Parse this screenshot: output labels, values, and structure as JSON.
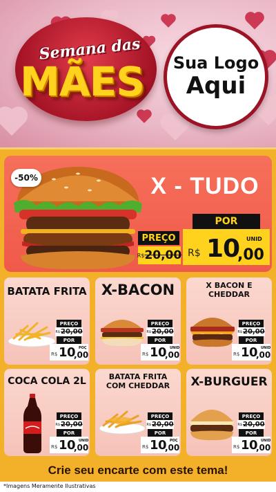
{
  "header": {
    "title_line1": "Semana das",
    "title_line2": "MÃES",
    "logo_line1": "Sua Logo",
    "logo_line2": "Aqui"
  },
  "featured": {
    "discount": "-50%",
    "name": "X - TUDO",
    "price_label": "PREÇO",
    "old_prefix": "R$",
    "old_price": "20,00",
    "por_label": "POR",
    "currency": "R$",
    "price_int": "10",
    "price_dec": ",00",
    "unit": "UNID"
  },
  "products": [
    {
      "name": "BATATA FRITA",
      "icon": "french-fries-icon",
      "price_label": "PREÇO",
      "old_prefix": "R$",
      "old_price": "20,00",
      "por_label": "POR",
      "currency": "R$",
      "price_int": "10",
      "price_dec": ",00",
      "unit": "POÇ"
    },
    {
      "name": "X-BACON",
      "icon": "burger-icon",
      "price_label": "PREÇO",
      "old_prefix": "R$",
      "old_price": "20,00",
      "por_label": "POR",
      "currency": "R$",
      "price_int": "10",
      "price_dec": ",00",
      "unit": "UNID"
    },
    {
      "name": "X BACON E CHEDDAR",
      "icon": "burger-icon",
      "price_label": "PREÇO",
      "old_prefix": "R$",
      "old_price": "20,00",
      "por_label": "POR",
      "currency": "R$",
      "price_int": "10",
      "price_dec": ",00",
      "unit": "UNID"
    },
    {
      "name": "COCA COLA 2L",
      "icon": "soda-bottle-icon",
      "price_label": "PREÇO",
      "old_prefix": "R$",
      "old_price": "20,00",
      "por_label": "POR",
      "currency": "R$",
      "price_int": "10",
      "price_dec": ",00",
      "unit": "UNID"
    },
    {
      "name": "BATATA FRITA COM CHEDDAR",
      "icon": "cheese-fries-icon",
      "price_label": "PREÇO",
      "old_prefix": "R$",
      "old_price": "20,00",
      "por_label": "POR",
      "currency": "R$",
      "price_int": "10",
      "price_dec": ",00",
      "unit": "POÇ"
    },
    {
      "name": "X-BURGUER",
      "icon": "burger-icon",
      "price_label": "PREÇO",
      "old_prefix": "R$",
      "old_price": "20,00",
      "por_label": "POR",
      "currency": "R$",
      "price_int": "10",
      "price_dec": ",00",
      "unit": "UNID"
    }
  ],
  "footer": {
    "cta": "Crie seu encarte com este tema!",
    "disclaimer": "*Imagens Meramente Ilustrativas"
  },
  "colors": {
    "panel": "#f3b12a",
    "featured_bg": "#f0594a",
    "card_bg": "#fbd8cf",
    "price_yellow": "#ffd21e",
    "brand_red": "#a51426"
  }
}
